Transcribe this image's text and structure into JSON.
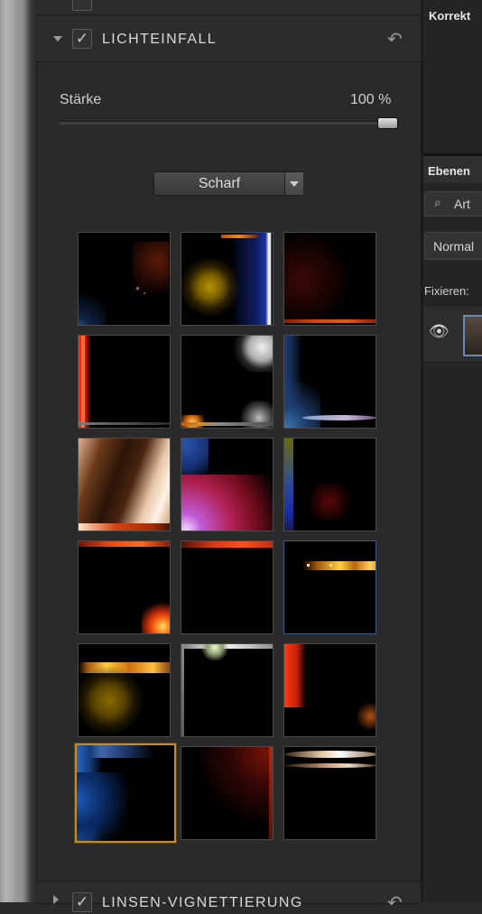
{
  "panel": {
    "section_title": "LICHTEINFALL",
    "strength_label": "Stärke",
    "strength_value": "100 %",
    "strength_level": 1.0,
    "dropdown_value": "Scharf",
    "bottom_section_title": "LINSEN-VIGNETTIERUNG"
  },
  "presets": {
    "count": 18,
    "selected_index": 15,
    "accent_color": "#c08d2a"
  },
  "right_panel": {
    "adjustments_title": "Korrekt",
    "layers_title": "Ebenen",
    "filter_label": "Art",
    "blend_mode": "Normal",
    "lock_label": "Fixieren:"
  }
}
